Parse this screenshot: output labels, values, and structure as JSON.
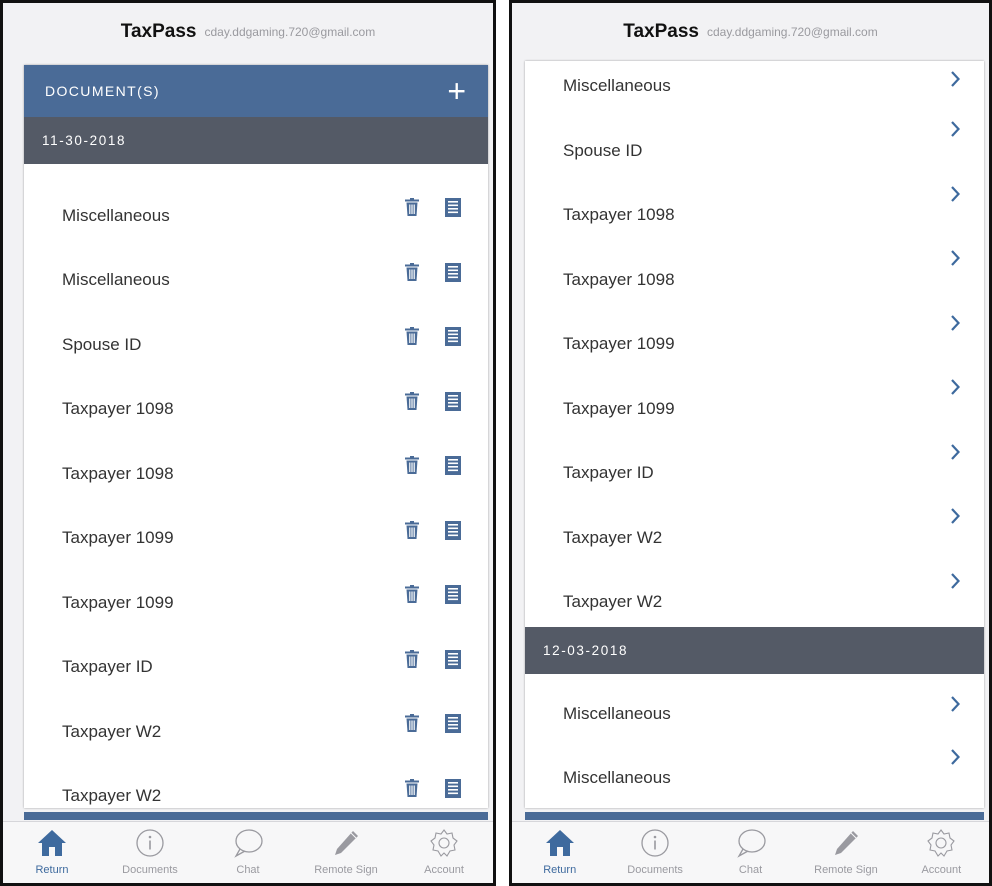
{
  "header": {
    "app_name": "TaxPass",
    "email": "cday.ddgaming.720@gmail.com"
  },
  "documents_bar": {
    "title": "DOCUMENT(S)",
    "add_icon": "plus-icon"
  },
  "left_screen": {
    "date": "11-30-2018",
    "items": [
      "Miscellaneous",
      "Miscellaneous",
      "Spouse ID",
      "Taxpayer 1098",
      "Taxpayer 1098",
      "Taxpayer 1099",
      "Taxpayer 1099",
      "Taxpayer ID",
      "Taxpayer W2",
      "Taxpayer W2"
    ]
  },
  "right_screen": {
    "items_top": [
      "Miscellaneous",
      "Spouse ID",
      "Taxpayer 1098",
      "Taxpayer 1098",
      "Taxpayer 1099",
      "Taxpayer 1099",
      "Taxpayer ID",
      "Taxpayer W2",
      "Taxpayer W2"
    ],
    "date2": "12-03-2018",
    "items_bottom": [
      "Miscellaneous",
      "Miscellaneous"
    ]
  },
  "tabs": [
    {
      "label": "Return",
      "icon": "home-icon",
      "active": true
    },
    {
      "label": "Documents",
      "icon": "info-icon",
      "active": false
    },
    {
      "label": "Chat",
      "icon": "chat-bubble-icon",
      "active": false
    },
    {
      "label": "Remote Sign",
      "icon": "pencil-icon",
      "active": false
    },
    {
      "label": "Account",
      "icon": "gear-icon",
      "active": false
    }
  ],
  "colors": {
    "primary_blue": "#4a6b97",
    "date_bar_gray": "#545a66",
    "active_tab": "#3e6a9e",
    "inactive_tab": "#9a9aa0"
  }
}
